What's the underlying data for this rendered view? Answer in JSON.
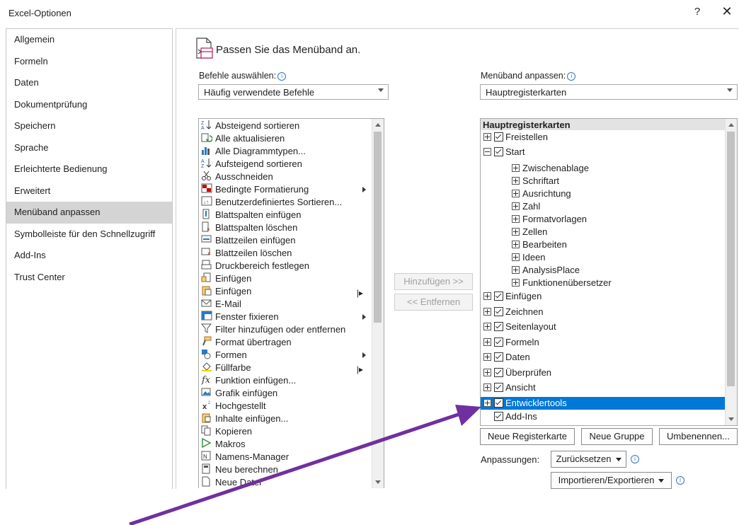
{
  "window": {
    "title": "Excel-Optionen",
    "help": "?",
    "close": "✕"
  },
  "nav": {
    "items": [
      {
        "label": "Allgemein",
        "selected": false
      },
      {
        "label": "Formeln",
        "selected": false
      },
      {
        "label": "Daten",
        "selected": false
      },
      {
        "label": "Dokumentprüfung",
        "selected": false
      },
      {
        "label": "Speichern",
        "selected": false
      },
      {
        "label": "Sprache",
        "selected": false
      },
      {
        "label": "Erleichterte Bedienung",
        "selected": false
      },
      {
        "label": "Erweitert",
        "selected": false
      },
      {
        "label": "Menüband anpassen",
        "selected": true
      },
      {
        "label": "Symbolleiste für den Schnellzugriff",
        "selected": false
      },
      {
        "label": "Add-Ins",
        "selected": false
      },
      {
        "label": "Trust Center",
        "selected": false
      }
    ]
  },
  "main": {
    "heading": "Passen Sie das Menüband an.",
    "left_label": "Befehle auswählen:",
    "left_dropdown": "Häufig verwendete Befehle",
    "right_label": "Menüband anpassen:",
    "right_dropdown": "Hauptregisterkarten",
    "add_button": "Hinzufügen >>",
    "remove_button": "<< Entfernen"
  },
  "commands": [
    {
      "label": "Absteigend sortieren",
      "icon": "sort-descending-icon"
    },
    {
      "label": "Alle aktualisieren",
      "icon": "refresh-all-icon"
    },
    {
      "label": "Alle Diagrammtypen...",
      "icon": "chart-types-icon"
    },
    {
      "label": "Aufsteigend sortieren",
      "icon": "sort-ascending-icon"
    },
    {
      "label": "Ausschneiden",
      "icon": "scissors-icon"
    },
    {
      "label": "Bedingte Formatierung",
      "icon": "conditional-format-icon",
      "submenu": "arrow"
    },
    {
      "label": "Benutzerdefiniertes Sortieren...",
      "icon": "custom-sort-icon"
    },
    {
      "label": "Blattspalten einfügen",
      "icon": "insert-columns-icon"
    },
    {
      "label": "Blattspalten löschen",
      "icon": "delete-columns-icon"
    },
    {
      "label": "Blattzeilen einfügen",
      "icon": "insert-rows-icon"
    },
    {
      "label": "Blattzeilen löschen",
      "icon": "delete-rows-icon"
    },
    {
      "label": "Druckbereich festlegen",
      "icon": "print-area-icon"
    },
    {
      "label": "Einfügen",
      "icon": "insert-icon"
    },
    {
      "label": "Einfügen",
      "icon": "paste-icon",
      "submenu": "split"
    },
    {
      "label": "E-Mail",
      "icon": "email-icon"
    },
    {
      "label": "Fenster fixieren",
      "icon": "freeze-panes-icon",
      "submenu": "arrow"
    },
    {
      "label": "Filter hinzufügen oder entfernen",
      "icon": "filter-icon"
    },
    {
      "label": "Format übertragen",
      "icon": "format-painter-icon"
    },
    {
      "label": "Formen",
      "icon": "shapes-icon",
      "submenu": "arrow"
    },
    {
      "label": "Füllfarbe",
      "icon": "fill-color-icon",
      "submenu": "split"
    },
    {
      "label": "Funktion einfügen...",
      "icon": "function-icon"
    },
    {
      "label": "Grafik einfügen",
      "icon": "picture-icon"
    },
    {
      "label": "Hochgestellt",
      "icon": "superscript-icon"
    },
    {
      "label": "Inhalte einfügen...",
      "icon": "paste-special-icon"
    },
    {
      "label": "Kopieren",
      "icon": "copy-icon"
    },
    {
      "label": "Makros",
      "icon": "macros-icon"
    },
    {
      "label": "Namens-Manager",
      "icon": "name-manager-icon"
    },
    {
      "label": "Neu berechnen",
      "icon": "calculator-icon"
    },
    {
      "label": "Neue Datei",
      "icon": "new-file-icon"
    }
  ],
  "ribbon_tree": {
    "header": "Hauptregisterkarten",
    "items": [
      {
        "label": "Freistellen",
        "level": 0,
        "expander": "plus",
        "checked": true
      },
      {
        "label": "Start",
        "level": 0,
        "expander": "minus",
        "checked": true
      },
      {
        "label": "Zwischenablage",
        "level": 1,
        "expander": "plus"
      },
      {
        "label": "Schriftart",
        "level": 1,
        "expander": "plus"
      },
      {
        "label": "Ausrichtung",
        "level": 1,
        "expander": "plus"
      },
      {
        "label": "Zahl",
        "level": 1,
        "expander": "plus"
      },
      {
        "label": "Formatvorlagen",
        "level": 1,
        "expander": "plus"
      },
      {
        "label": "Zellen",
        "level": 1,
        "expander": "plus"
      },
      {
        "label": "Bearbeiten",
        "level": 1,
        "expander": "plus"
      },
      {
        "label": "Ideen",
        "level": 1,
        "expander": "plus"
      },
      {
        "label": "AnalysisPlace",
        "level": 1,
        "expander": "plus"
      },
      {
        "label": "Funktionenübersetzer",
        "level": 1,
        "expander": "plus"
      },
      {
        "label": "Einfügen",
        "level": 0,
        "expander": "plus",
        "checked": true
      },
      {
        "label": "Zeichnen",
        "level": 0,
        "expander": "plus",
        "checked": true
      },
      {
        "label": "Seitenlayout",
        "level": 0,
        "expander": "plus",
        "checked": true
      },
      {
        "label": "Formeln",
        "level": 0,
        "expander": "plus",
        "checked": true
      },
      {
        "label": "Daten",
        "level": 0,
        "expander": "plus",
        "checked": true
      },
      {
        "label": "Überprüfen",
        "level": 0,
        "expander": "plus",
        "checked": true
      },
      {
        "label": "Ansicht",
        "level": 0,
        "expander": "plus",
        "checked": true
      },
      {
        "label": "Entwicklertools",
        "level": 0,
        "expander": "plus",
        "checked": true,
        "selected": true
      },
      {
        "label": "Add-Ins",
        "level": 0,
        "expander": "none",
        "checked": true
      }
    ]
  },
  "buttons": {
    "new_tab": "Neue Registerkarte",
    "new_group": "Neue Gruppe",
    "rename": "Umbenennen...",
    "customizations_label": "Anpassungen:",
    "reset": "Zurücksetzen",
    "import_export": "Importieren/Exportieren"
  },
  "colors": {
    "selection": "#0078d7",
    "arrow": "#7030a0",
    "nav_selected": "#d4d4d4"
  }
}
